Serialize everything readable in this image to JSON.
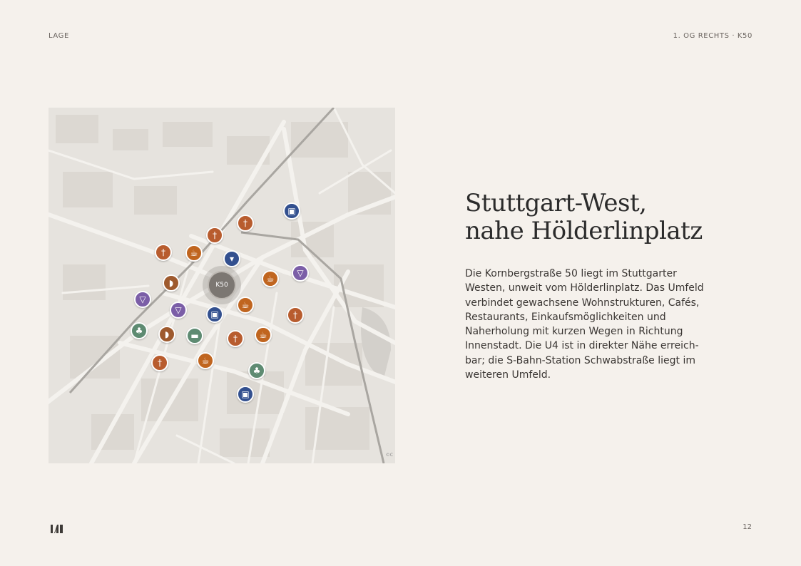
{
  "header": {
    "section": "LAGE",
    "unit": "1. OG RECHTS · K50"
  },
  "map": {
    "center_label": "K50",
    "copyright": "©C",
    "colors": {
      "food": "#b85c2e",
      "cafe": "#c0651f",
      "bar": "#7b5ea7",
      "transit": "#33508f",
      "shop": "#33508f",
      "park": "#5e8b72",
      "bakery": "#9e5a2e",
      "health": "#5e8b72"
    },
    "pins": [
      {
        "type": "transit",
        "icon": "tram-icon"
      },
      {
        "type": "food",
        "icon": "fork-knife-icon"
      },
      {
        "type": "food",
        "icon": "fork-knife-icon"
      },
      {
        "type": "food",
        "icon": "fork-knife-icon"
      },
      {
        "type": "cafe",
        "icon": "coffee-icon"
      },
      {
        "type": "shop",
        "icon": "basket-icon"
      },
      {
        "type": "cafe",
        "icon": "coffee-icon"
      },
      {
        "type": "bar",
        "icon": "cocktail-icon"
      },
      {
        "type": "bakery",
        "icon": "croissant-icon"
      },
      {
        "type": "bar",
        "icon": "cocktail-icon"
      },
      {
        "type": "bar",
        "icon": "cocktail-icon"
      },
      {
        "type": "transit",
        "icon": "tram-icon"
      },
      {
        "type": "cafe",
        "icon": "coffee-icon"
      },
      {
        "type": "food",
        "icon": "fork-knife-icon"
      },
      {
        "type": "park",
        "icon": "tree-icon"
      },
      {
        "type": "bakery",
        "icon": "croissant-icon"
      },
      {
        "type": "health",
        "icon": "pill-icon"
      },
      {
        "type": "food",
        "icon": "fork-knife-icon"
      },
      {
        "type": "cafe",
        "icon": "coffee-icon"
      },
      {
        "type": "food",
        "icon": "fork-knife-icon"
      },
      {
        "type": "cafe",
        "icon": "coffee-icon"
      },
      {
        "type": "park",
        "icon": "tree-icon"
      },
      {
        "type": "transit",
        "icon": "tram-icon"
      }
    ]
  },
  "content": {
    "title_line1": "Stuttgart-West,",
    "title_line2": "nahe Hölderlinplatz",
    "body": "Die Kornbergstraße 50 liegt im Stuttgarter Westen, unweit vom Hölderlinplatz. Das Umfeld verbindet gewachsene Wohnstrukturen, Cafés, Restaurants, Einkaufsmöglichkeiten und Naherholung mit kurzen Wegen in Richtung Innenstadt. Die U4 ist in direkter Nähe erreich­bar; die S-Bahn-Station Schwabstraße liegt im weiteren Umfeld."
  },
  "footer": {
    "page_number": "12"
  }
}
